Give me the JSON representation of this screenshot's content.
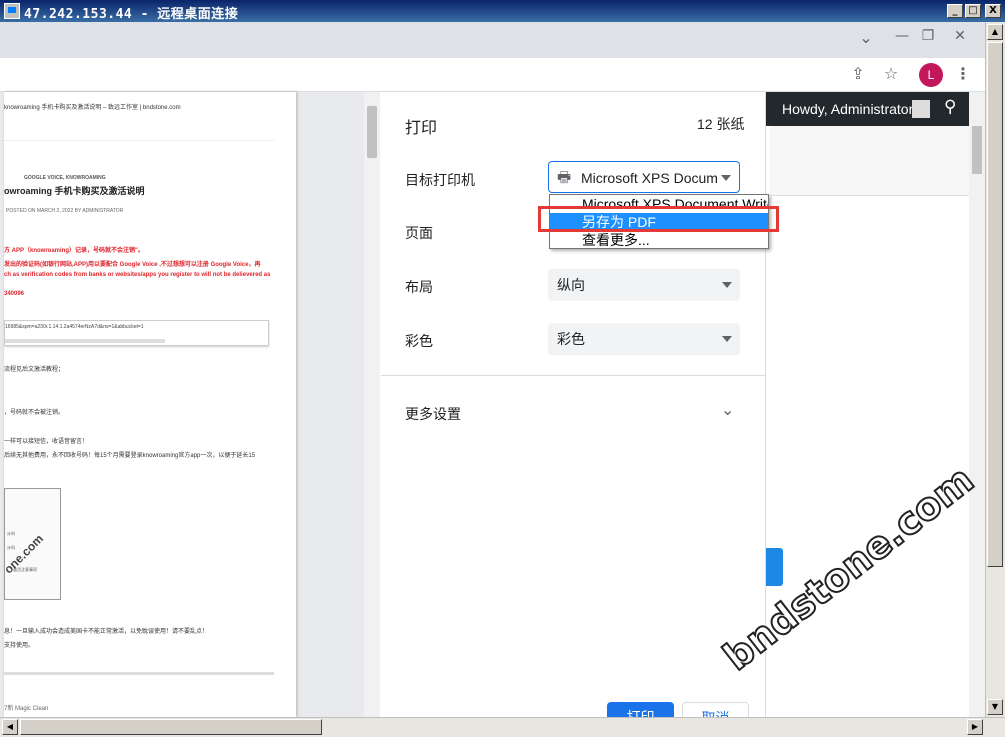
{
  "window": {
    "title": "47.242.153.44 - 远程桌面连接",
    "buttons": [
      "_",
      "□",
      "X"
    ]
  },
  "dialog": {
    "title": "打印",
    "sheet_count": "12 张纸",
    "destination_label": "目标打印机",
    "destination_value": "Microsoft XPS Docum",
    "pages_label": "页面",
    "layout_label": "布局",
    "layout_value": "纵向",
    "color_label": "彩色",
    "color_value": "彩色",
    "more_settings_label": "更多设置",
    "print_button": "打印",
    "cancel_button": "取消"
  },
  "dropdown": {
    "options": [
      "Microsoft XPS Document Writer",
      "另存为 PDF",
      "查看更多..."
    ],
    "selected_index": 1
  },
  "wp_bar": {
    "greeting": "Howdy, Administrator"
  },
  "avatar_letter": "L",
  "watermark": "bndstone.com",
  "preview": {
    "header": "knowroaming 手机卡购买及激活说明 – 致远工作室 | bndstone.com",
    "category": "GOOGLE VOICE, KNOWROAMING",
    "heading": "owroaming 手机卡购买及激活说明",
    "meta": "POSTED ON MARCH 2, 2022 BY ADMINISTRATOR",
    "red_lines": [
      "方 APP（knowroaming）记录，号码就不会注销\"。",
      "发出的验证码(如银行网站,APP)用以要配合 Google Voice ,不过想想可以注册 Google Voice，再",
      "ch as verification codes from banks or websites/apps you register to will not be delievered as",
      "340096"
    ],
    "url_line": "16985&spm=a230r.1.14.1.2a4574erNzA7d&ns=1&abbucket=1",
    "lines": [
      "流程见后文激活教程；",
      "，号码就不会被注销。",
      "一样可以接短信，收语音留言！",
      "后续无其他费用，永不回收号码！每15个月需要登录knowroaming官方app一次，以便于延长15",
      "息！一旦输入成功会造成美国卡不能正常激活，以免耽误使用！请不要乱点！",
      "支持使用。",
      "7新 Magic Clean"
    ],
    "image_text": "one.com",
    "image_small": [
      "计科",
      "计科",
      "激活注意事项"
    ]
  }
}
